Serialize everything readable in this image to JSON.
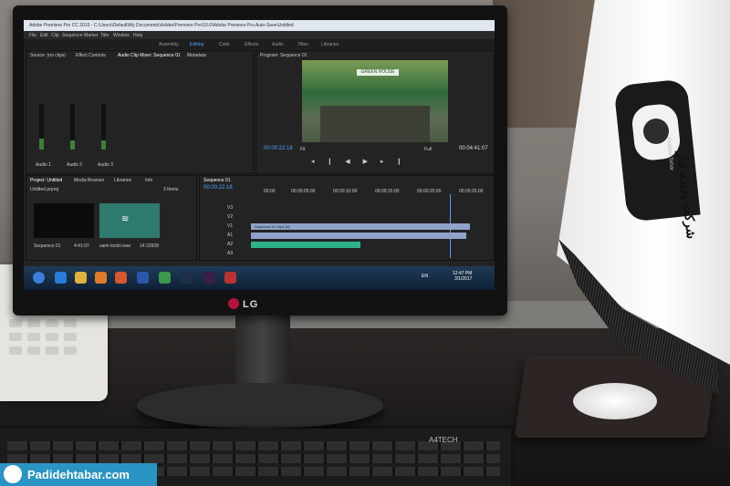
{
  "photo": {
    "monitor_brand": "LG",
    "keyboard_brand": "A4TECH",
    "watermark_text": "Padidehtabar.com"
  },
  "premiere": {
    "title": "Adobe Premiere Pro CC 2015 - C:\\Users\\Default\\My Documents\\Adobe\\Premiere Pro\\10.0\\Adobe Premiere Pro Auto-Save\\Untitled",
    "menu": [
      "File",
      "Edit",
      "Clip",
      "Sequence",
      "Marker",
      "Title",
      "Window",
      "Help"
    ],
    "workspaces": [
      "Assembly",
      "Editing",
      "Color",
      "Effects",
      "Audio",
      "Titles",
      "Libraries"
    ],
    "active_workspace": "Editing",
    "mixer_tabs": [
      "Source: (no clips)",
      "Effect Controls",
      "Audio Clip Mixer: Sequence 01",
      "Metadata"
    ],
    "mixer_channels": [
      "Audio 1",
      "Audio 2",
      "Audio 3"
    ],
    "program_title": "Program: Sequence 01",
    "program_timecode": "00:00:22:18",
    "program_duration": "00:04:41:07",
    "program_zoom": "Fit",
    "program_quality": "Full",
    "video_sign": "GREEN HOUSE",
    "project_tabs": [
      "Project: Untitled",
      "Media Browser",
      "Libraries",
      "Info"
    ],
    "project_file": "Untitled.prproj",
    "project_count": "3 Items",
    "project_items": [
      {
        "name": "Sequence 01",
        "duration": "4:41:07"
      },
      {
        "name": "sami tools\\.wav",
        "duration": "14:22828"
      }
    ],
    "timeline_title": "Sequence 01",
    "timeline_timecode": "00:00:22:18",
    "ruler": [
      "00:00",
      "00:00:05:00",
      "00:00:10:00",
      "00:00:15:00",
      "00:00:20:00",
      "00:00:25:00"
    ],
    "tracks": [
      "V3",
      "V2",
      "V1",
      "A1",
      "A2",
      "A3"
    ],
    "clip_label": "Sequence 01.mp4 [V]",
    "tray_lang": "EN",
    "tray_time": "12:47 PM",
    "tray_date": "3/1/2017"
  },
  "flag": {
    "text_brand": "PadidehTabar",
    "text_fa": "شرکت پدیده تبار"
  },
  "colors": {
    "premiere_blue": "#4fa3ff",
    "watermark_bg": "#2a94c4",
    "audio_clip": "#2fb08a",
    "video_clip": "#8fa2c8"
  }
}
